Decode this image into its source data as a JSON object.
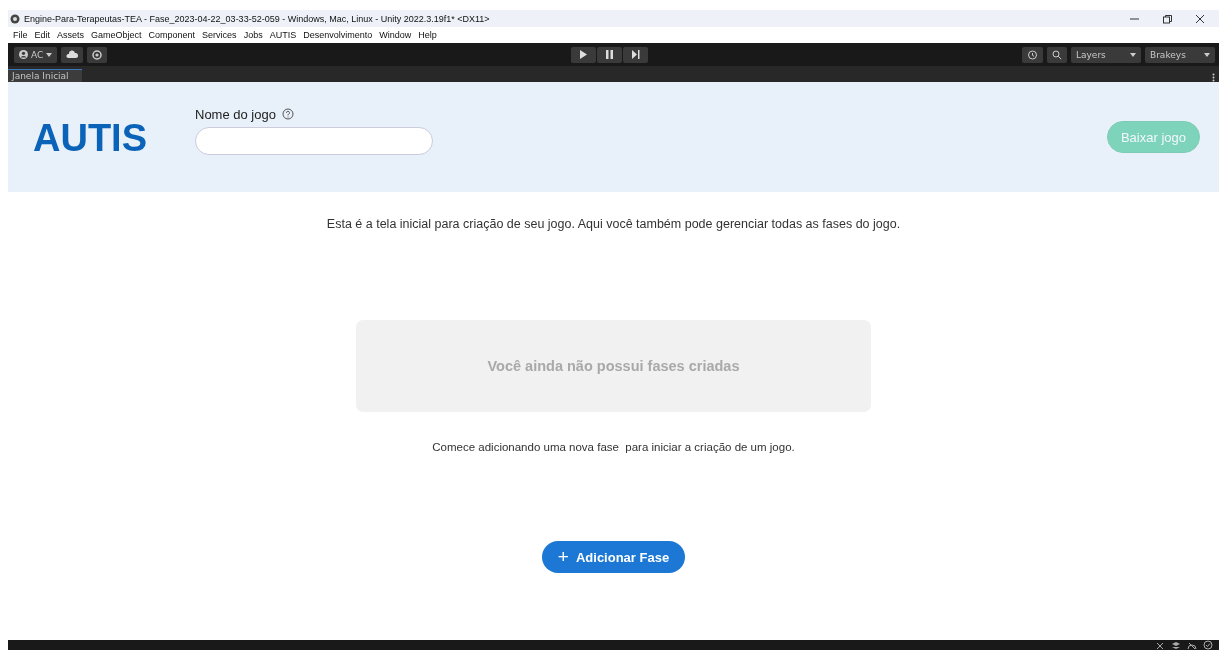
{
  "window": {
    "title": "Engine-Para-Terapeutas-TEA - Fase_2023-04-22_03-33-52-059 - Windows, Mac, Linux - Unity 2022.3.19f1* <DX11>"
  },
  "menu": [
    "File",
    "Edit",
    "Assets",
    "GameObject",
    "Component",
    "Services",
    "Jobs",
    "AUTIS",
    "Desenvolvimento",
    "Window",
    "Help"
  ],
  "toolbar": {
    "account": "AC",
    "layers": "Layers",
    "layout": "Brakeys"
  },
  "tabs": [
    {
      "label": "Janela Inicial",
      "selected": true
    }
  ],
  "header": {
    "logo": "AUTIS",
    "field_label": "Nome do jogo",
    "download_button": {
      "label": "Baixar jogo",
      "disabled": true
    }
  },
  "intro": "Esta é a tela inicial para criação de seu jogo. Aqui você também pode gerenciar todas as fases do jogo.",
  "empty_state": "Você ainda não possui fases criadas",
  "hint": "Comece adicionando uma nova fase  para iniciar a criação de um jogo.",
  "add_button": {
    "icon": "+",
    "label": "Adicionar Fase"
  }
}
